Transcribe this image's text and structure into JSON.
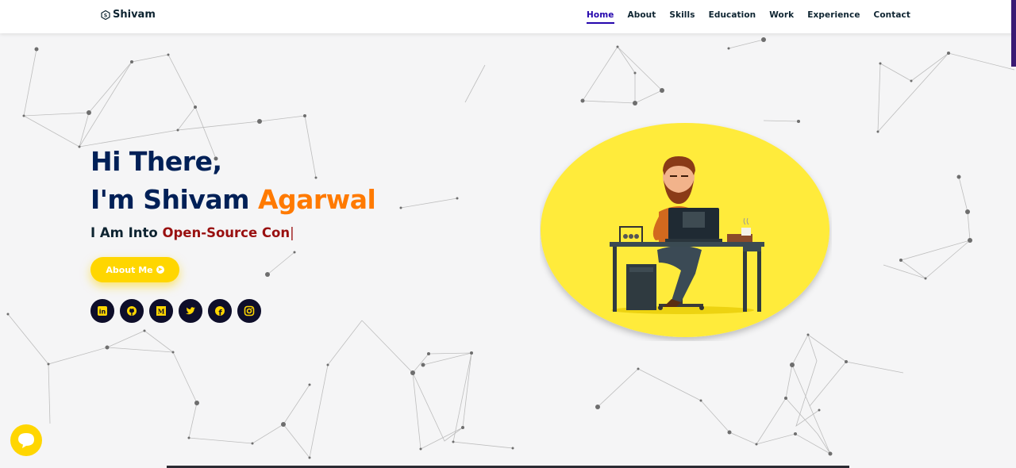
{
  "logo": {
    "text": "Shivam",
    "icon": "logo-mark-icon"
  },
  "nav": {
    "items": [
      {
        "label": "Home",
        "active": true
      },
      {
        "label": "About",
        "active": false
      },
      {
        "label": "Skills",
        "active": false
      },
      {
        "label": "Education",
        "active": false
      },
      {
        "label": "Work",
        "active": false
      },
      {
        "label": "Experience",
        "active": false
      },
      {
        "label": "Contact",
        "active": false
      }
    ]
  },
  "hero": {
    "greeting": "Hi There,",
    "intro": "I'm Shivam",
    "surname": "Agarwal",
    "typed_prefix": "I Am Into",
    "typed_text": "Open-Source Con",
    "cursor": "|"
  },
  "about_button": {
    "label": "About Me",
    "icon": "arrow-circle-icon"
  },
  "socials": [
    {
      "name": "linkedin-icon",
      "text": "in"
    },
    {
      "name": "github-icon"
    },
    {
      "name": "medium-icon",
      "text": "M"
    },
    {
      "name": "twitter-icon"
    },
    {
      "name": "facebook-icon",
      "text": "f"
    },
    {
      "name": "instagram-icon"
    }
  ],
  "colors": {
    "accent_yellow": "#ffd600",
    "heading_blue": "#002057",
    "accent_orange": "#ff7a00",
    "typed_red": "#991010",
    "nav_active": "#2506ad"
  }
}
